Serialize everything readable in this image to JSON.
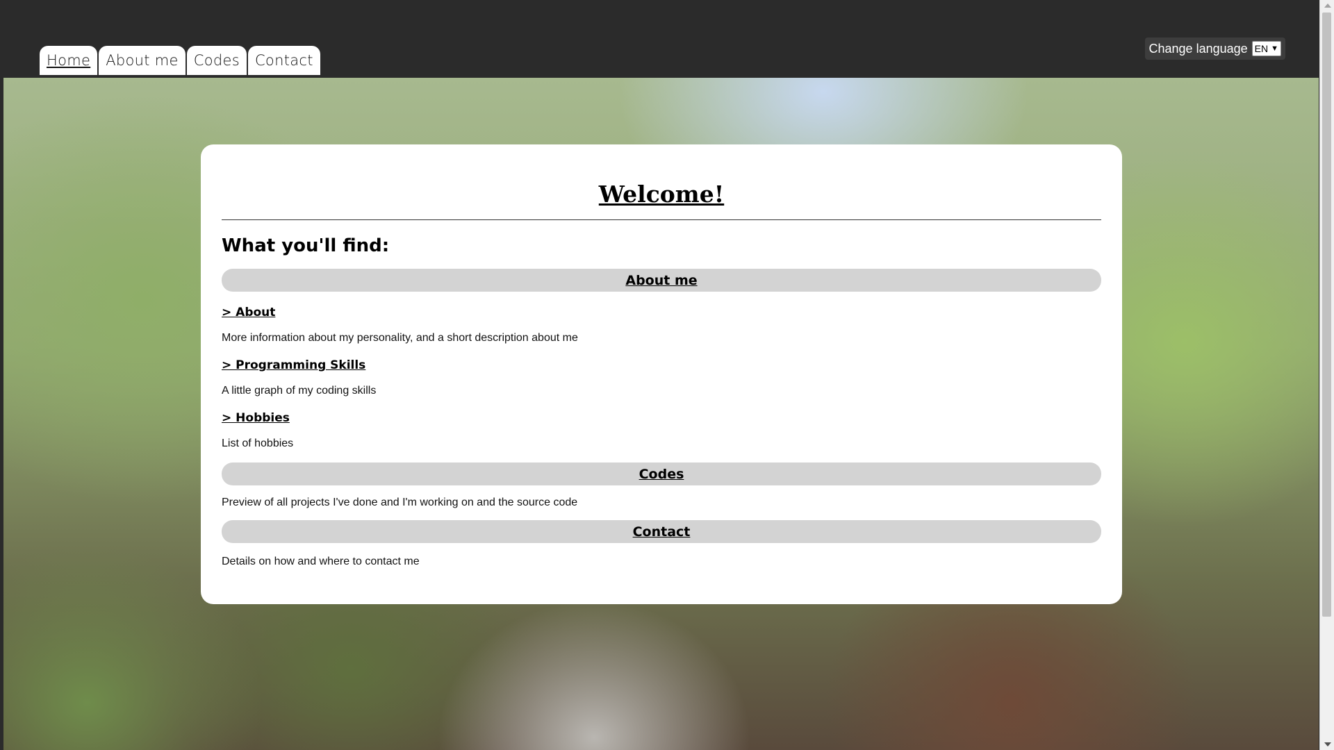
{
  "nav": {
    "tabs": [
      {
        "label": "Home",
        "active": true
      },
      {
        "label": "About me"
      },
      {
        "label": "Codes"
      },
      {
        "label": "Contact"
      }
    ]
  },
  "language": {
    "label": "Change language",
    "selected": "EN"
  },
  "content": {
    "title": "Welcome!",
    "subtitle": "What you'll find:",
    "sections": {
      "about": {
        "header": "About me",
        "items": [
          {
            "title": "> About",
            "description": "More information about my personality, and a short description about me"
          },
          {
            "title": "> Programming Skills",
            "description": "A little graph of my coding skills"
          },
          {
            "title": "> Hobbies",
            "description": "List of hobbies"
          }
        ]
      },
      "codes": {
        "header": "Codes",
        "description": "Preview of all projects I've done and I'm working on and the source code"
      },
      "contact": {
        "header": "Contact",
        "description": "Details on how and where to contact me"
      }
    }
  }
}
